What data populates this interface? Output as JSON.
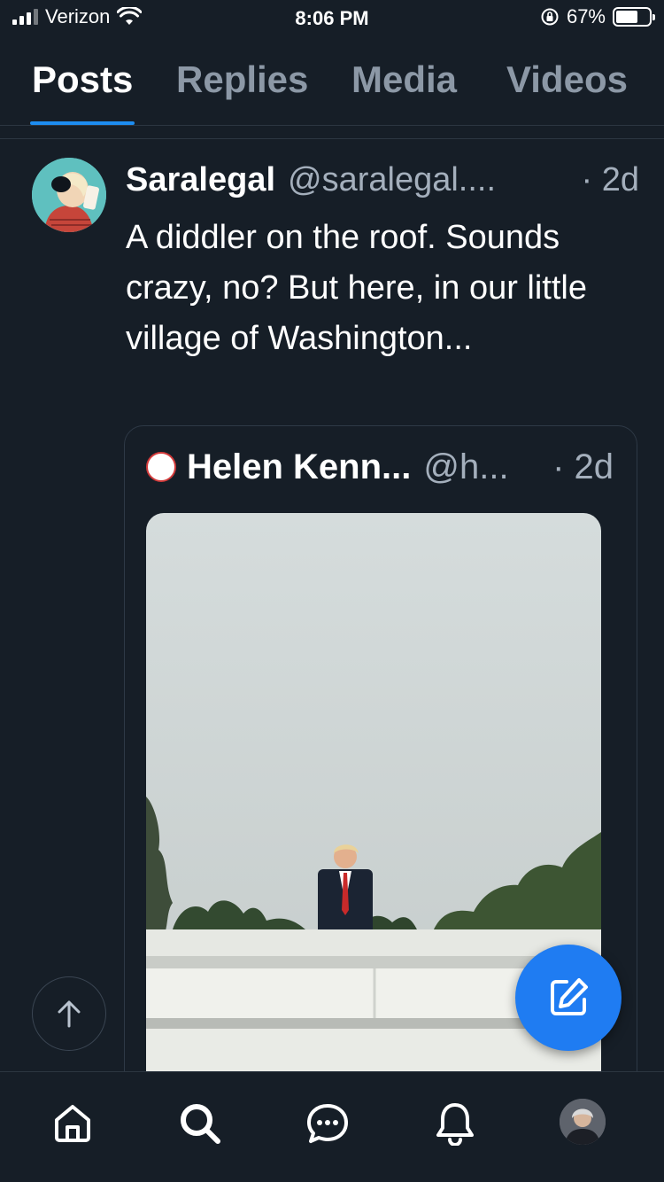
{
  "status_bar": {
    "carrier": "Verizon",
    "time": "8:06 PM",
    "battery_percent": "67%",
    "battery_level": 0.67
  },
  "tabs": [
    {
      "label": "Posts",
      "active": true
    },
    {
      "label": "Replies",
      "active": false
    },
    {
      "label": "Media",
      "active": false
    },
    {
      "label": "Videos",
      "active": false
    }
  ],
  "post": {
    "author_name": "Saralegal",
    "author_handle": "@saralegal....",
    "time": "· 2d",
    "text": "A diddler on the roof. Sounds crazy, no? But here, in our little village of Washington..."
  },
  "quote": {
    "author_name": "Helen Kenn...",
    "author_handle": "@h...",
    "time": "· 2d"
  },
  "colors": {
    "background": "#161e27",
    "accent": "#1d8cf0",
    "compose": "#1f7cf2",
    "muted_text": "#a4afbc"
  },
  "icons": {
    "home": "home-icon",
    "search": "search-icon",
    "chat": "chat-icon",
    "notifications": "bell-icon",
    "compose": "compose-icon",
    "scroll_top": "arrow-up-icon"
  }
}
